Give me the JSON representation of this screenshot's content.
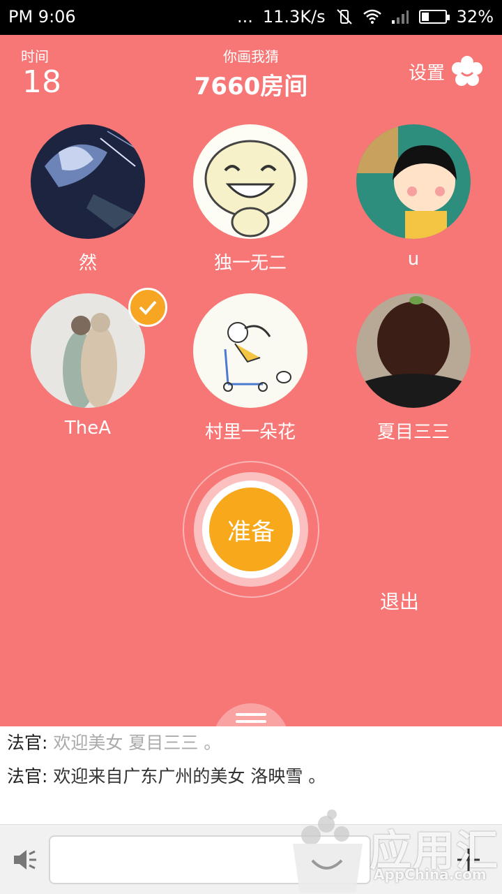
{
  "status_bar": {
    "time": "PM 9:06",
    "dots": "...",
    "net_speed": "11.3K/s",
    "battery": "32%",
    "battery_level": 0.32
  },
  "header": {
    "timer_label": "时间",
    "timer_value": "18",
    "game_name": "你画我猜",
    "room_name": "7660房间",
    "settings_label": "设置"
  },
  "players": [
    {
      "name": "然",
      "ready": false,
      "avatar": "anime-character-avatar"
    },
    {
      "name": "独一无二",
      "ready": false,
      "avatar": "smiling-cat-cartoon-avatar"
    },
    {
      "name": "u",
      "ready": false,
      "avatar": "chibi-maruko-avatar"
    },
    {
      "name": "TheA",
      "ready": true,
      "avatar": "hugging-couple-photo-avatar"
    },
    {
      "name": "村里一朵花",
      "ready": false,
      "avatar": "scooter-girl-drawing-avatar"
    },
    {
      "name": "夏目三三",
      "ready": false,
      "avatar": "back-of-head-photo-avatar"
    }
  ],
  "actions": {
    "ready_label": "准备",
    "exit_label": "退出"
  },
  "chat": {
    "messages": [
      {
        "speaker": "法官",
        "separator": ": ",
        "text": "欢迎美女 夏目三三 。",
        "faded": true
      },
      {
        "speaker": "法官",
        "separator": ": ",
        "text": "欢迎来自广东广州的美女 洛映雪 。",
        "faded": false
      }
    ],
    "input_value": ""
  },
  "watermark": {
    "title": "应用汇",
    "site": "AppChina.com"
  },
  "colors": {
    "background": "#f77777",
    "ready_button": "#f7a81b",
    "ready_check": "#f6a623"
  }
}
